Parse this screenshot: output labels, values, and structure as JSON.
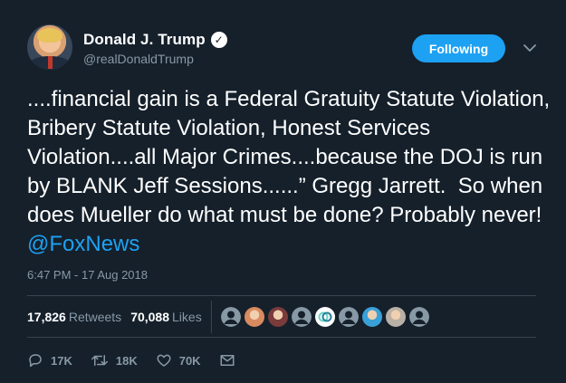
{
  "user": {
    "display_name": "Donald J. Trump",
    "handle": "@realDonaldTrump",
    "verified": true
  },
  "follow_button_label": "Following",
  "tweet": {
    "text": "....financial gain is a Federal Gratuity Statute Violation, Bribery Statute Violation, Honest Services Violation....all Major Crimes....because the DOJ is run by BLANK Jeff Sessions......” Gregg Jarrett.  So when does Mueller do what must be done? Probably never! ",
    "mention": "@FoxNews"
  },
  "timestamp": "6:47 PM - 17 Aug 2018",
  "stats": {
    "retweets_count": "17,826",
    "retweets_label": "Retweets",
    "likes_count": "70,088",
    "likes_label": "Likes"
  },
  "retweeter_avatars": [
    {
      "kind": "default",
      "color": "#8899a6"
    },
    {
      "kind": "photo",
      "color": "#d98b5f"
    },
    {
      "kind": "photo",
      "color": "#7a3b3b"
    },
    {
      "kind": "default",
      "color": "#8899a6"
    },
    {
      "kind": "logo",
      "color": "#6dd3c8"
    },
    {
      "kind": "default",
      "color": "#8899a6"
    },
    {
      "kind": "photo",
      "color": "#3aa0d8"
    },
    {
      "kind": "photo",
      "color": "#b9b1a6"
    },
    {
      "kind": "default",
      "color": "#8899a6"
    }
  ],
  "actions": {
    "reply_count": "17K",
    "retweet_count": "18K",
    "like_count": "70K",
    "icons": [
      "reply-icon",
      "retweet-icon",
      "like-icon",
      "direct-message-icon"
    ]
  },
  "colors": {
    "background": "#15202b",
    "accent": "#1da1f2",
    "muted": "#8899a6",
    "divider": "#38444d"
  }
}
